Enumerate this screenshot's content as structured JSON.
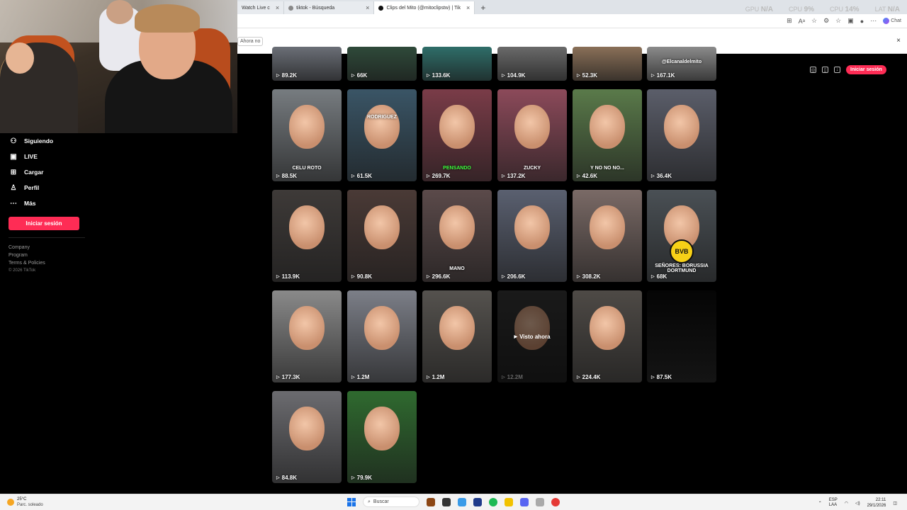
{
  "browser": {
    "tabs": [
      {
        "label": "Watch Live c",
        "active": false
      },
      {
        "label": "tiktok - Búsqueda",
        "active": false
      },
      {
        "label": "Clips del Mito (@mitoclipstw) | Tik",
        "active": true
      }
    ],
    "new_tab": "+",
    "notice_button": "Ahora no",
    "chat_label": "Chat",
    "stats": [
      {
        "label": "GPU",
        "value": "N/A"
      },
      {
        "label": "CPU",
        "value": "9%"
      },
      {
        "label": "CPU",
        "value": "14%"
      },
      {
        "label": "LAT",
        "value": "N/A"
      }
    ]
  },
  "sidebar": {
    "items": [
      {
        "label": "Siguiendo",
        "icon": "following-icon"
      },
      {
        "label": "LIVE",
        "icon": "live-icon"
      },
      {
        "label": "Cargar",
        "icon": "upload-icon"
      },
      {
        "label": "Perfil",
        "icon": "profile-icon"
      },
      {
        "label": "Más",
        "icon": "more-icon"
      }
    ],
    "login": "Iniciar sesión",
    "footer": [
      "Company",
      "Program",
      "Terms & Policies"
    ],
    "copyright": "© 2026 TikTok"
  },
  "header": {
    "login": "Iniciar sesión"
  },
  "videos": [
    {
      "views": "89.2K",
      "bg": "#6b6f77"
    },
    {
      "views": "66K",
      "bg": "#2f4a3a"
    },
    {
      "views": "133.6K",
      "bg": "#2f6e69"
    },
    {
      "views": "104.9K",
      "bg": "#6a6a6a"
    },
    {
      "views": "52.3K",
      "bg": "#8a7058"
    },
    {
      "views": "167.1K",
      "bg": "#8b8b8b",
      "caption": "@Elcanaldelmito"
    },
    {
      "views": "88.5K",
      "bg": "#777c80",
      "caption": "CELU ROTO"
    },
    {
      "views": "61.5K",
      "bg": "#3a5566",
      "caption": "RODRIGUEZ"
    },
    {
      "views": "269.7K",
      "bg": "#7a3c48",
      "caption": "PENSANDO"
    },
    {
      "views": "137.2K",
      "bg": "#8c4a5a",
      "caption": "ZUCKY"
    },
    {
      "views": "42.6K",
      "bg": "#5a7a4a",
      "caption": "Y NO NO NO..."
    },
    {
      "views": "36.4K",
      "bg": "#5b5e6a"
    },
    {
      "views": "113.9K",
      "bg": "#3e3a38"
    },
    {
      "views": "90.8K",
      "bg": "#4a3a36"
    },
    {
      "views": "296.6K",
      "bg": "#5b4a4a",
      "caption": "MANO"
    },
    {
      "views": "206.6K",
      "bg": "#5a6070"
    },
    {
      "views": "308.2K",
      "bg": "#7a6a66"
    },
    {
      "views": "68K",
      "bg": "#4a5055",
      "caption": "SEÑORES: BORUSSIA DORTMUND"
    },
    {
      "views": "177.3K",
      "bg": "#8a8a8a"
    },
    {
      "views": "1.2M",
      "bg": "#7c7f88"
    },
    {
      "views": "1.2M",
      "bg": "#55524e"
    },
    {
      "views": "12.2M",
      "bg": "#3a3a3a",
      "watched": "Visto ahora"
    },
    {
      "views": "224.4K",
      "bg": "#4e4a46"
    },
    {
      "views": "87.5K",
      "bg": "#050505"
    },
    {
      "views": "84.8K",
      "bg": "#6c6c70"
    },
    {
      "views": "79.9K",
      "bg": "#2f6a2f"
    }
  ],
  "taskbar": {
    "temp": "25°C",
    "weather": "Parc. soleado",
    "search": "Buscar",
    "lang1": "ESP",
    "lang2": "LAA",
    "time": "22:11",
    "date": "29/1/2026"
  }
}
